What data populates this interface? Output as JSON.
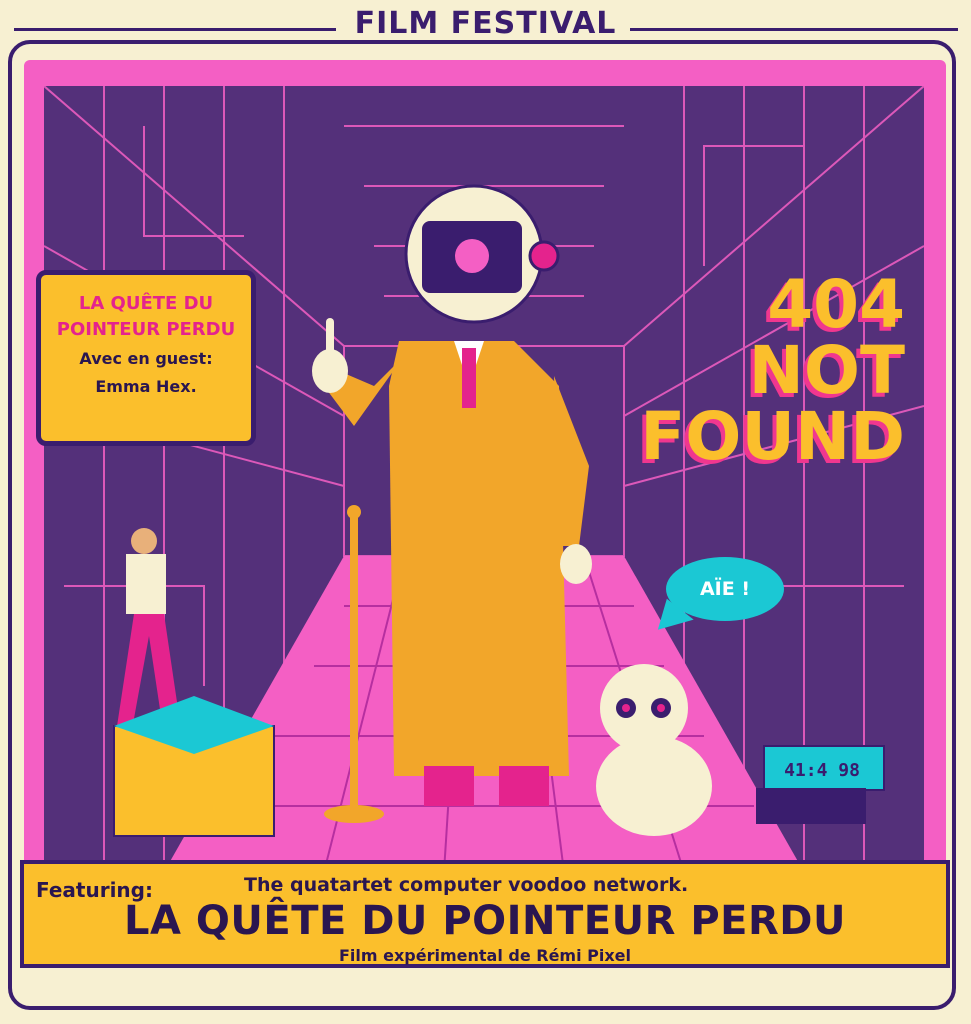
{
  "header": {
    "title": "FILM FESTIVAL"
  },
  "title_box": {
    "title": "LA QUÊTE DU POINTEUR PERDU",
    "guest_line1": "Avec en guest:",
    "guest_line2": "Emma Hex."
  },
  "headline": {
    "line1": "404",
    "line2": "NOT",
    "line3": "FOUND"
  },
  "speech_bubble": {
    "text": "AÏE !"
  },
  "device_display": {
    "text": "41:4 98"
  },
  "banner": {
    "featuring": "Featuring:",
    "tagline": "The quatartet computer voodoo network.",
    "title": "LA QUÊTE DU POINTEUR PERDU",
    "credit": "Film expérimental de Rémi Pixel"
  },
  "colors": {
    "cream": "#f7f0d2",
    "pink": "#f45fc4",
    "purple": "#54307a",
    "navy": "#3a1d6e",
    "yellow": "#fbbf2c",
    "orange": "#f2a62a",
    "teal": "#1bc8d4"
  }
}
